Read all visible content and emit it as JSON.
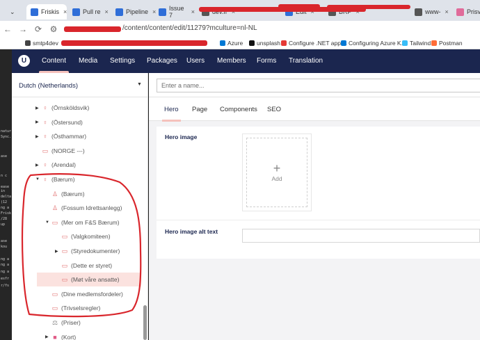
{
  "browser": {
    "tabs": [
      {
        "label": "Friskis"
      },
      {
        "label": "Pull re"
      },
      {
        "label": "Pipeline"
      },
      {
        "label": "Issue 7"
      },
      {
        "label": "dev.fr"
      },
      {
        "label": "Edit"
      },
      {
        "label": "BRP"
      },
      {
        "label": "www-"
      },
      {
        "label": "Prisvän"
      }
    ],
    "url": "/content/content/edit/11279?mculture=nl-NL",
    "bookmarks": [
      {
        "label": "smtp4dev",
        "color": "#444444"
      },
      {
        "label": "Azure",
        "color": "#0078d4"
      },
      {
        "label": "unsplash",
        "color": "#111111"
      },
      {
        "label": "Configure .NET appl...",
        "color": "#e53935"
      },
      {
        "label": "Configuring Azure K...",
        "color": "#0078d4"
      },
      {
        "label": "Tailwind",
        "color": "#38bdf8"
      },
      {
        "label": "Postman",
        "color": "#ff6c37"
      }
    ]
  },
  "terminal_lines": [
    "natur",
    "Sync.",
    "ase",
    "n c",
    "ease",
    "in",
    "delta",
    "(12",
    "ng a",
    "Frisk",
    "/28",
    "up",
    "ase",
    "kou",
    "ng a",
    "ng a",
    "ng a",
    "esfr",
    "r/fs"
  ],
  "header": {
    "logo": "U",
    "sections": [
      "Content",
      "Media",
      "Settings",
      "Packages",
      "Users",
      "Members",
      "Forms",
      "Translation"
    ],
    "active_section": "Content"
  },
  "tree": {
    "culture": "Dutch (Netherlands)",
    "nodes": [
      {
        "label": "(Örnsköldsvik)",
        "has_arrow": true,
        "expanded": false,
        "icon": "person-pin-icon"
      },
      {
        "label": "(Östersund)",
        "has_arrow": true,
        "expanded": false,
        "icon": "person-pin-icon"
      },
      {
        "label": "(Östhammar)",
        "has_arrow": true,
        "expanded": false,
        "icon": "person-pin-icon"
      },
      {
        "label": "(NORGE ---)",
        "has_arrow": false,
        "expanded": false,
        "icon": "document-icon"
      },
      {
        "label": "(Arendal)",
        "has_arrow": true,
        "expanded": false,
        "icon": "person-pin-icon"
      },
      {
        "label": "(Bærum)",
        "has_arrow": true,
        "expanded": true,
        "icon": "person-pin-icon"
      },
      {
        "label": "(Bærum)",
        "has_arrow": false,
        "expanded": false,
        "icon": "person-icon"
      },
      {
        "label": "(Fossum Idrettsanlegg)",
        "has_arrow": false,
        "expanded": false,
        "icon": "person-icon"
      },
      {
        "label": "(Mer om F&S Bærum)",
        "has_arrow": true,
        "expanded": true,
        "icon": "document-icon"
      },
      {
        "label": "(Valgkomiteen)",
        "has_arrow": false,
        "expanded": false,
        "icon": "document-icon"
      },
      {
        "label": "(Styredokumenter)",
        "has_arrow": true,
        "expanded": false,
        "icon": "document-icon"
      },
      {
        "label": "(Dette er styret)",
        "has_arrow": false,
        "expanded": false,
        "icon": "document-icon"
      },
      {
        "label": "(Møt våre ansatte)",
        "has_arrow": false,
        "expanded": false,
        "icon": "document-icon",
        "selected": true
      },
      {
        "label": "(Dine medlemsfordeler)",
        "has_arrow": false,
        "expanded": false,
        "icon": "document-icon"
      },
      {
        "label": "(Trivselsregler)",
        "has_arrow": false,
        "expanded": false,
        "icon": "document-icon"
      },
      {
        "label": "(Priser)",
        "has_arrow": false,
        "expanded": false,
        "icon": "scale-icon"
      },
      {
        "label": "(Kort)",
        "has_arrow": true,
        "expanded": false,
        "icon": "folder-icon"
      }
    ]
  },
  "editor": {
    "name_placeholder": "Enter a name...",
    "tabs": [
      "Hero",
      "Page",
      "Components",
      "SEO"
    ],
    "active_tab": "Hero",
    "properties": {
      "hero_image_label": "Hero image",
      "add_label": "Add",
      "hero_alt_label": "Hero image alt text"
    }
  },
  "colors": {
    "header_bg": "#1b264f",
    "accent": "#f5c1bc",
    "selected_row": "#fbe2df",
    "annotation": "#d9262c"
  }
}
